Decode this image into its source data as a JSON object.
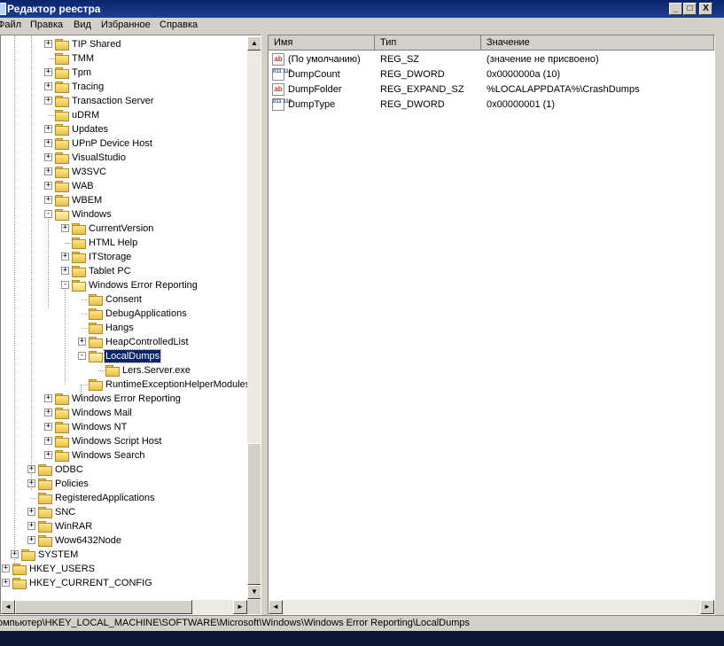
{
  "window": {
    "title": "Редактор реестра",
    "min_glyph": "_",
    "max_glyph": "□",
    "close_glyph": "X"
  },
  "menu": [
    {
      "label": "Файл"
    },
    {
      "label": "Правка"
    },
    {
      "label": "Вид"
    },
    {
      "label": "Избранное"
    },
    {
      "label": "Справка"
    }
  ],
  "tree": [
    {
      "label": "TIP Shared",
      "expander": "+"
    },
    {
      "label": "TMM",
      "expander": ""
    },
    {
      "label": "Tpm",
      "expander": "+"
    },
    {
      "label": "Tracing",
      "expander": "+"
    },
    {
      "label": "Transaction Server",
      "expander": "+"
    },
    {
      "label": "uDRM",
      "expander": ""
    },
    {
      "label": "Updates",
      "expander": "+"
    },
    {
      "label": "UPnP Device Host",
      "expander": "+"
    },
    {
      "label": "VisualStudio",
      "expander": "+"
    },
    {
      "label": "W3SVC",
      "expander": "+"
    },
    {
      "label": "WAB",
      "expander": "+"
    },
    {
      "label": "WBEM",
      "expander": "+"
    },
    {
      "label": "Windows",
      "expander": "-"
    },
    {
      "label": "CurrentVersion",
      "expander": "+"
    },
    {
      "label": "HTML Help",
      "expander": ""
    },
    {
      "label": "ITStorage",
      "expander": "+"
    },
    {
      "label": "Tablet PC",
      "expander": "+"
    },
    {
      "label": "Windows Error Reporting",
      "expander": "-"
    },
    {
      "label": "Consent",
      "expander": ""
    },
    {
      "label": "DebugApplications",
      "expander": ""
    },
    {
      "label": "Hangs",
      "expander": ""
    },
    {
      "label": "HeapControlledList",
      "expander": "+"
    },
    {
      "label": "LocalDumps",
      "expander": "-",
      "selected": true
    },
    {
      "label": "Lers.Server.exe",
      "expander": ""
    },
    {
      "label": "RuntimeExceptionHelperModules",
      "expander": ""
    },
    {
      "label": "Windows Error Reporting",
      "expander": "+"
    },
    {
      "label": "Windows Mail",
      "expander": "+"
    },
    {
      "label": "Windows NT",
      "expander": "+"
    },
    {
      "label": "Windows Script Host",
      "expander": "+"
    },
    {
      "label": "Windows Search",
      "expander": "+"
    },
    {
      "label": "ODBC",
      "expander": "+"
    },
    {
      "label": "Policies",
      "expander": "+"
    },
    {
      "label": "RegisteredApplications",
      "expander": ""
    },
    {
      "label": "SNC",
      "expander": "+"
    },
    {
      "label": "WinRAR",
      "expander": "+"
    },
    {
      "label": "Wow6432Node",
      "expander": "+"
    },
    {
      "label": "SYSTEM",
      "expander": "+"
    },
    {
      "label": "HKEY_USERS",
      "expander": "+"
    },
    {
      "label": "HKEY_CURRENT_CONFIG",
      "expander": "+"
    }
  ],
  "columns": {
    "name": "Имя",
    "type": "Тип",
    "value": "Значение"
  },
  "values": [
    {
      "name": "(По умолчанию)",
      "type": "REG_SZ",
      "value": "(значение не присвоено)",
      "icon": "string-value-icon",
      "glyph": "ab"
    },
    {
      "name": "DumpCount",
      "type": "REG_DWORD",
      "value": "0x0000000a (10)",
      "icon": "binary-value-icon",
      "glyph": "011 110"
    },
    {
      "name": "DumpFolder",
      "type": "REG_EXPAND_SZ",
      "value": "%LOCALAPPDATA%\\CrashDumps",
      "icon": "string-value-icon",
      "glyph": "ab"
    },
    {
      "name": "DumpType",
      "type": "REG_DWORD",
      "value": "0x00000001 (1)",
      "icon": "binary-value-icon",
      "glyph": "011 110"
    }
  ],
  "scroll": {
    "up": "▲",
    "down": "▼",
    "left": "◄",
    "right": "►"
  },
  "status": {
    "path": "омпьютер\\HKEY_LOCAL_MACHINE\\SOFTWARE\\Microsoft\\Windows\\Windows Error Reporting\\LocalDumps"
  }
}
